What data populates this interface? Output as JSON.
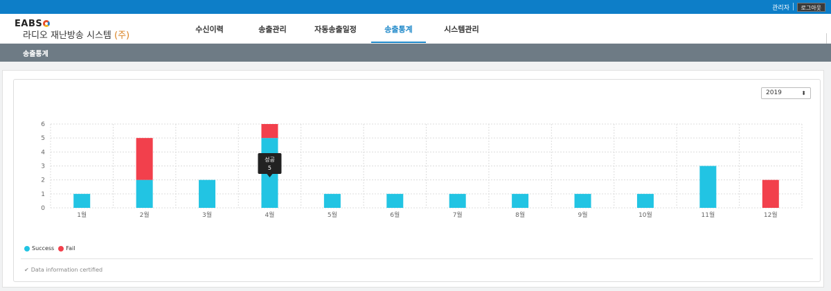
{
  "topbar": {
    "admin_label": "관리자",
    "logout_label": "로그아웃"
  },
  "header": {
    "logo_text": "EABS",
    "system_name": "라디오 재난방송 시스템",
    "system_suffix": "(주)"
  },
  "nav": {
    "tabs": [
      {
        "label": "수신이력",
        "active": false
      },
      {
        "label": "송출관리",
        "active": false
      },
      {
        "label": "자동송출일정",
        "active": false
      },
      {
        "label": "송출통계",
        "active": true
      },
      {
        "label": "시스템관리",
        "active": false
      }
    ]
  },
  "subbar": {
    "title": "송출통계"
  },
  "year_select": {
    "value": "2019"
  },
  "colors": {
    "success": "#22c4e3",
    "fail": "#f2404c",
    "accent": "#0d7ec8"
  },
  "chart_data": {
    "type": "bar",
    "stacked": true,
    "categories": [
      "1월",
      "2월",
      "3월",
      "4월",
      "5월",
      "6월",
      "7월",
      "8월",
      "9월",
      "10월",
      "11월",
      "12월"
    ],
    "series": [
      {
        "name": "Success",
        "values": [
          1,
          2,
          2,
          5,
          1,
          1,
          1,
          1,
          1,
          1,
          3,
          0
        ]
      },
      {
        "name": "Fail",
        "values": [
          0,
          3,
          0,
          1,
          0,
          0,
          0,
          0,
          0,
          0,
          0,
          2
        ]
      }
    ],
    "ylim": [
      0,
      6
    ],
    "yticks": [
      0,
      1,
      2,
      3,
      4,
      5,
      6
    ],
    "grid": true,
    "legend_position": "bottom-left",
    "tooltip": {
      "title": "성공",
      "value": "5",
      "category_index": 3
    }
  },
  "footer": {
    "text": "Data information certified"
  }
}
